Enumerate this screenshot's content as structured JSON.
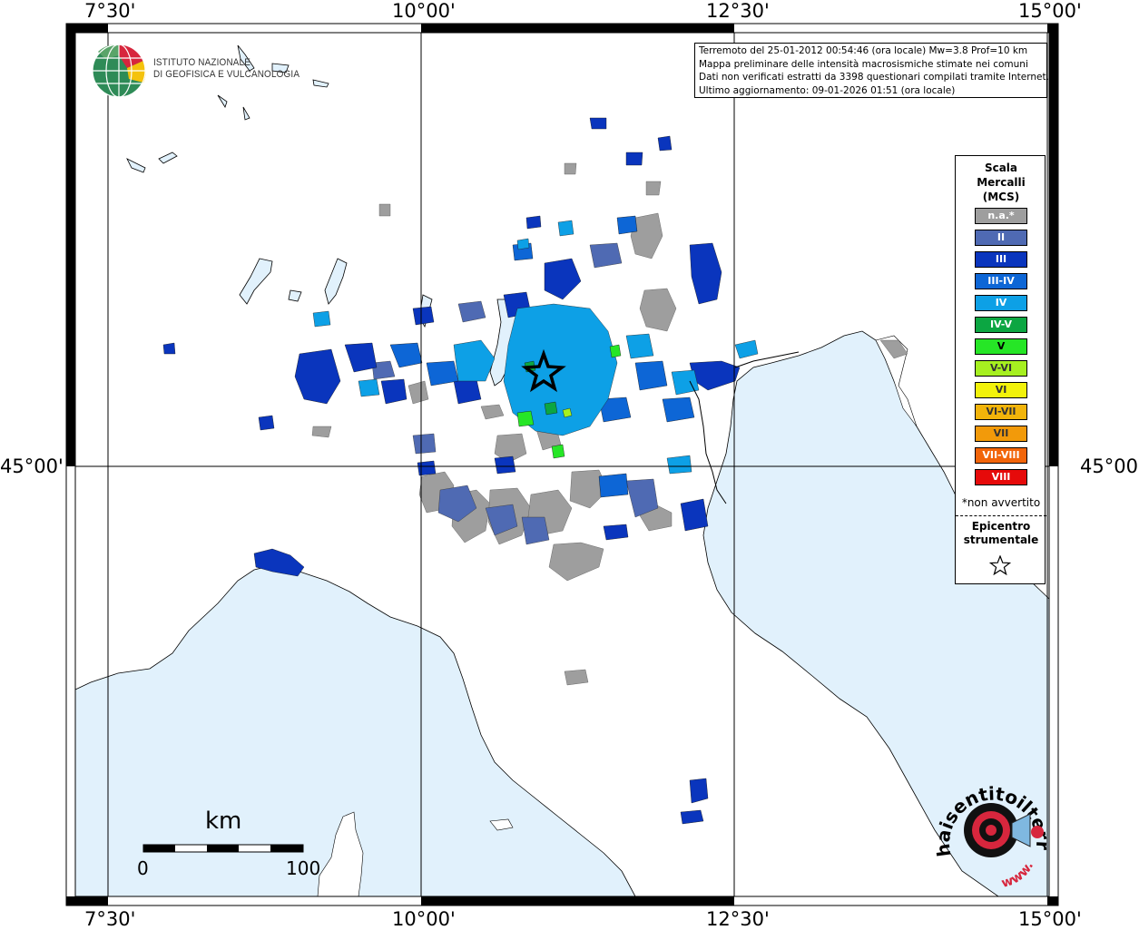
{
  "map": {
    "top_labels": [
      "7°30'",
      "10°00'",
      "12°30'",
      "15°00'"
    ],
    "bottom_labels": [
      "7°30'",
      "10°00'",
      "12°30'",
      "15°00'"
    ],
    "left_lat_label": "45°00'",
    "right_lat_label": "45°00'",
    "colors": {
      "sea": "#e1f1fc",
      "land": "#ffffff",
      "lake": "#e1f1fc",
      "grid": "#000000",
      "na": "#9e9e9e",
      "II": "#4f6ab3",
      "III": "#0a35bd",
      "III-IV": "#0d66d6",
      "IV": "#0da0e6",
      "IV-V": "#0ca642",
      "V": "#26e626",
      "V-VI": "#a6f020"
    }
  },
  "institute": {
    "name_line1": "ISTITUTO NAZIONALE",
    "name_line2": "DI GEOFISICA E VULCANOLOGIA",
    "logo_icon": "ingv-globe-icon"
  },
  "info": {
    "line1": "Terremoto del 25-01-2012 00:54:46 (ora locale) Mw=3.8 Prof=10 km",
    "line2": "Mappa preliminare delle intensità macrosismiche stimate nei comuni",
    "line3": "Dati non verificati estratti da 3398 questionari compilati tramite Internet.",
    "line4": "Ultimo aggiornamento: 09-01-2026 01:51 (ora locale)"
  },
  "legend": {
    "title_line1": "Scala",
    "title_line2": "Mercalli",
    "title_line3": "(MCS)",
    "items": [
      {
        "label": "n.a.*",
        "color": "#9e9e9e"
      },
      {
        "label": "II",
        "color": "#4f6ab3"
      },
      {
        "label": "III",
        "color": "#0a35bd"
      },
      {
        "label": "III-IV",
        "color": "#0d66d6"
      },
      {
        "label": "IV",
        "color": "#0da0e6"
      },
      {
        "label": "IV-V",
        "color": "#0ca642"
      },
      {
        "label": "V",
        "color": "#26e626"
      },
      {
        "label": "V-VI",
        "color": "#a6f020"
      },
      {
        "label": "VI",
        "color": "#f2f20a"
      },
      {
        "label": "VI-VII",
        "color": "#f2b40a"
      },
      {
        "label": "VII",
        "color": "#f29a0a"
      },
      {
        "label": "VII-VIII",
        "color": "#f2650a"
      },
      {
        "label": "VIII",
        "color": "#e60a0a"
      }
    ],
    "footnote": "*non avvertito",
    "epicenter_line1": "Epicentro",
    "epicenter_line2": "strumentale",
    "epicenter_icon": "star-icon"
  },
  "scale_bar": {
    "unit": "km",
    "start": "0",
    "end": "100"
  },
  "website_logo": {
    "text": "haisentitoilterremoto.it",
    "url_text": "www.",
    "icon": "target-speaker-icon"
  }
}
